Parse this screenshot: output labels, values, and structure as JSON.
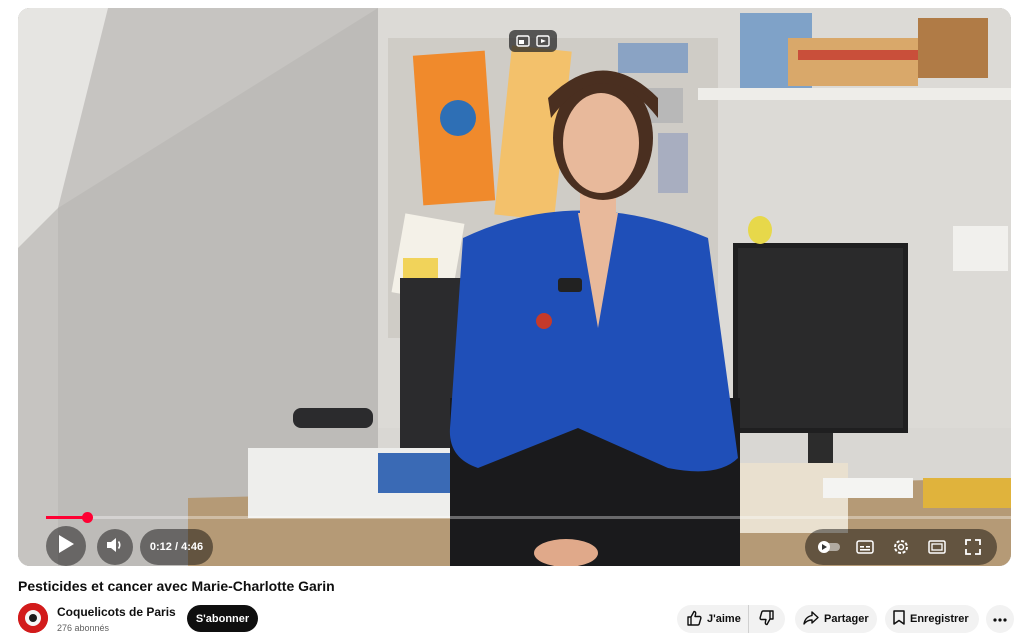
{
  "video": {
    "title": "Pesticides et cancer avec Marie-Charlotte Garin",
    "current_time": "0:12",
    "duration": "4:46",
    "time_display": "0:12 / 4:46",
    "progress_fraction": 0.042
  },
  "channel": {
    "name": "Coquelicots de Paris",
    "subscribers": "276 abonnés",
    "subscribe_label": "S'abonner",
    "avatar_color": "#d21b1b"
  },
  "actions": {
    "like_label": "J'aime",
    "share_label": "Partager",
    "save_label": "Enregistrer"
  },
  "icons": {
    "play": "play-icon",
    "volume": "volume-icon",
    "autoplay": "autoplay-toggle-icon",
    "subtitles": "subtitles-icon",
    "settings": "gear-icon",
    "theater": "theater-mode-icon",
    "fullscreen": "fullscreen-icon",
    "miniplayer": "miniplayer-icon",
    "cast": "cast-icon",
    "like": "thumbs-up-icon",
    "dislike": "thumbs-down-icon",
    "share": "share-icon",
    "save": "bookmark-icon",
    "more": "more-icon"
  },
  "colors": {
    "progress": "#ff0033",
    "subscribe_bg": "#0f0f0f",
    "pill_bg": "#f2f2f2"
  }
}
